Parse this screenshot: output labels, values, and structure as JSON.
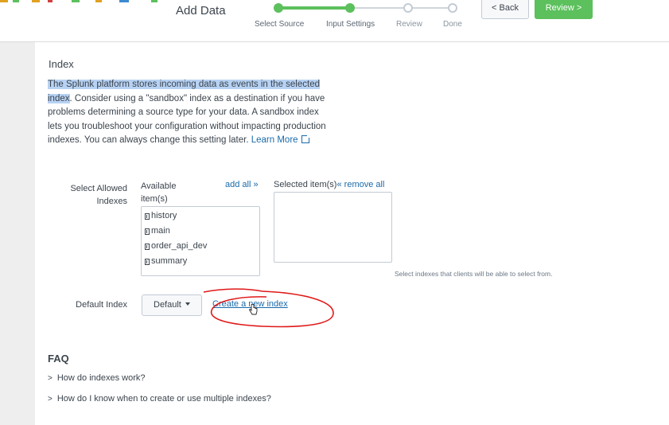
{
  "header": {
    "title": "Add Data",
    "steps": [
      {
        "label": "Select Source",
        "state": "done"
      },
      {
        "label": "Input Settings",
        "state": "current"
      },
      {
        "label": "Review",
        "state": "pending"
      },
      {
        "label": "Done",
        "state": "pending"
      }
    ],
    "back_label": "< Back",
    "review_label": "Review >"
  },
  "index_section": {
    "title": "Index",
    "description_highlighted": "The Splunk platform stores incoming data as events in the selected index",
    "description_rest": ". Consider using a \"sandbox\" index as a destination if you have problems determining a source type for your data. A sandbox index lets you troubleshoot your configuration without impacting production indexes. You can always change this setting later. ",
    "learn_more": "Learn More"
  },
  "allowed_indexes": {
    "label": "Select Allowed Indexes",
    "available_header": "Available item(s)",
    "add_all": "add all »",
    "selected_header": "Selected item(s)",
    "remove_all": "« remove all",
    "available_items": [
      "history",
      "main",
      "order_api_dev",
      "summary"
    ],
    "hint": "Select indexes that clients will be able to select from."
  },
  "default_index": {
    "label": "Default Index",
    "value": "Default",
    "create_link": "Create a new index"
  },
  "faq": {
    "title": "FAQ",
    "items": [
      "How do indexes work?",
      "How do I know when to create or use multiple indexes?"
    ]
  },
  "colors": {
    "accent_green": "#5cc05c",
    "link_blue": "#1a6aaa",
    "highlight": "#b7d2f3",
    "annotation_red": "#e01818"
  },
  "icons": {
    "list_item": "index-item-icon",
    "external_link": "external-link-icon",
    "caret": "caret-down-icon",
    "cursor": "hand-pointer-icon",
    "chevron": "chevron-right-icon"
  }
}
